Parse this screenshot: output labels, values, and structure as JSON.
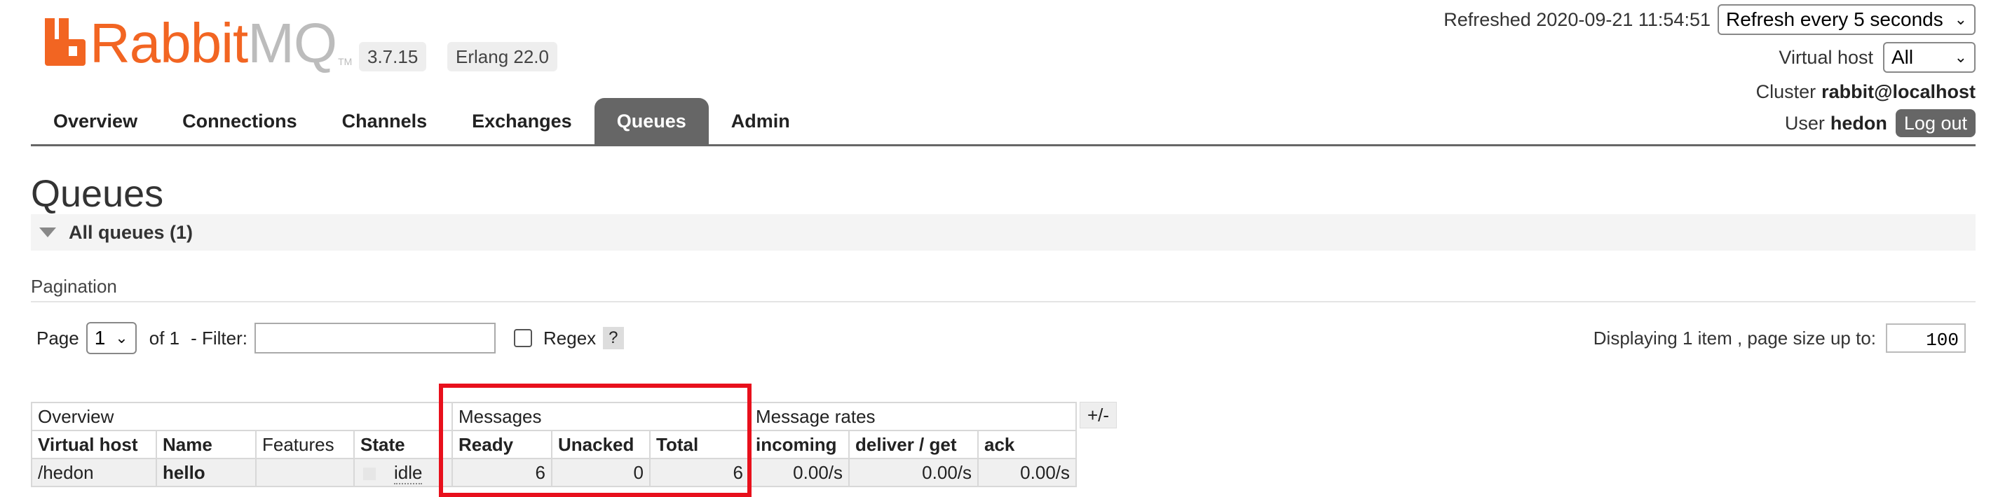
{
  "header": {
    "logo_text_rabbit": "Rabbit",
    "logo_text_mq": "MQ",
    "logo_tm": "TM",
    "rabbitmq_version": "3.7.15",
    "erlang_version": "Erlang 22.0",
    "refreshed_label": "Refreshed 2020-09-21 11:54:51",
    "refresh_select": "Refresh every 5 seconds",
    "virtual_host_label": "Virtual host",
    "virtual_host_select": "All",
    "cluster_label": "Cluster",
    "cluster_value": "rabbit@localhost",
    "user_label": "User",
    "user_value": "hedon",
    "logout_label": "Log out"
  },
  "tabs": [
    {
      "label": "Overview",
      "active": false
    },
    {
      "label": "Connections",
      "active": false
    },
    {
      "label": "Channels",
      "active": false
    },
    {
      "label": "Exchanges",
      "active": false
    },
    {
      "label": "Queues",
      "active": true
    },
    {
      "label": "Admin",
      "active": false
    }
  ],
  "page": {
    "title": "Queues",
    "section_label": "All queues (1)",
    "pagination_label": "Pagination"
  },
  "pagination": {
    "page_label": "Page",
    "page_value": "1",
    "of_label": "of 1",
    "filter_label": "- Filter:",
    "filter_value": "",
    "regex_label": "Regex",
    "help_label": "?",
    "display_label": "Displaying 1 item , page size up to:",
    "page_size": "100"
  },
  "table": {
    "groups": [
      "Overview",
      "Messages",
      "Message rates"
    ],
    "columns": [
      "Virtual host",
      "Name",
      "Features",
      "State",
      "Ready",
      "Unacked",
      "Total",
      "incoming",
      "deliver / get",
      "ack"
    ],
    "row": {
      "virtual_host": "/hedon",
      "name": "hello",
      "features": "",
      "state": "idle",
      "ready": "6",
      "unacked": "0",
      "total": "6",
      "incoming": "0.00/s",
      "deliver_get": "0.00/s",
      "ack": "0.00/s"
    },
    "toggle_label": "+/-"
  },
  "colors": {
    "brand_orange": "#f26522",
    "tab_active": "#666666",
    "highlight": "#e8101c"
  }
}
